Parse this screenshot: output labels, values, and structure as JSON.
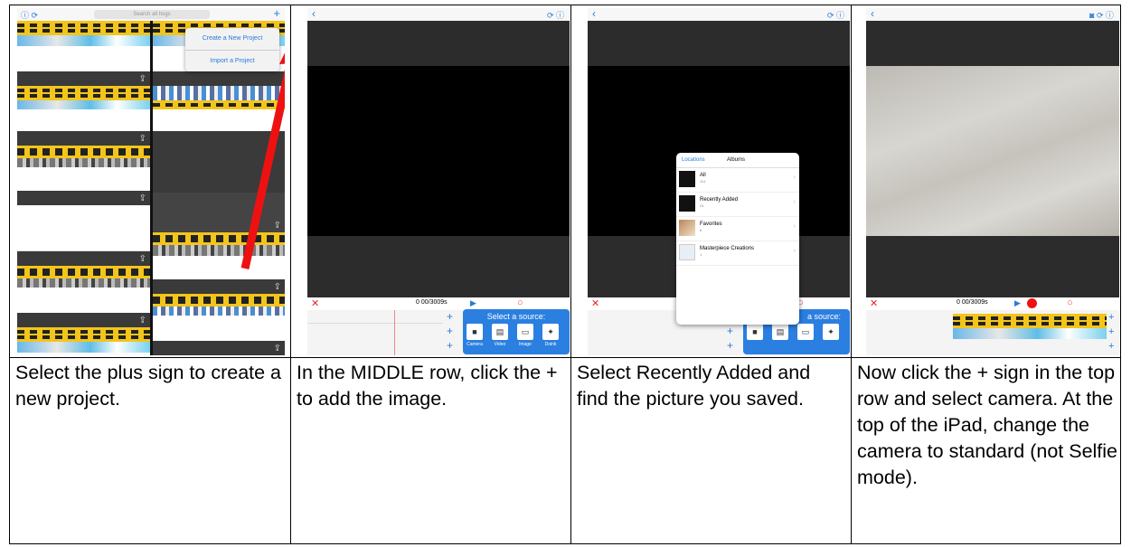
{
  "captions": [
    "Select the plus sign to create a new project.",
    "In the MIDDLE row, click the + to add the image.",
    "Select Recently Added and find the picture you saved.",
    "Now click the + sign in the top row and select camera. At the top of the iPad, change the camera to standard (not Selfie mode)."
  ],
  "screen1": {
    "search_placeholder": "Search all hogs",
    "plus": "+",
    "menu": [
      "Create a New Project",
      "Import a Project"
    ]
  },
  "screen2": {
    "back": "‹",
    "time": "0 00/3009s",
    "source_title": "Select a source:",
    "sources": [
      "Camera",
      "Video",
      "Image",
      "Doink"
    ]
  },
  "screen3": {
    "tabs": [
      "Locations",
      "Albums"
    ],
    "albums": [
      {
        "name": "All",
        "count": "114"
      },
      {
        "name": "Recently Added",
        "count": "24"
      },
      {
        "name": "Favorites",
        "count": "6"
      },
      {
        "name": "Masterpiece Creations",
        "count": "1"
      }
    ],
    "source_title": "a source:"
  },
  "screen4": {
    "time": "0 00/3009s"
  },
  "colors": {
    "accent": "#2b7fe0",
    "arrow": "#ee1111",
    "film": "#f3c51b"
  }
}
